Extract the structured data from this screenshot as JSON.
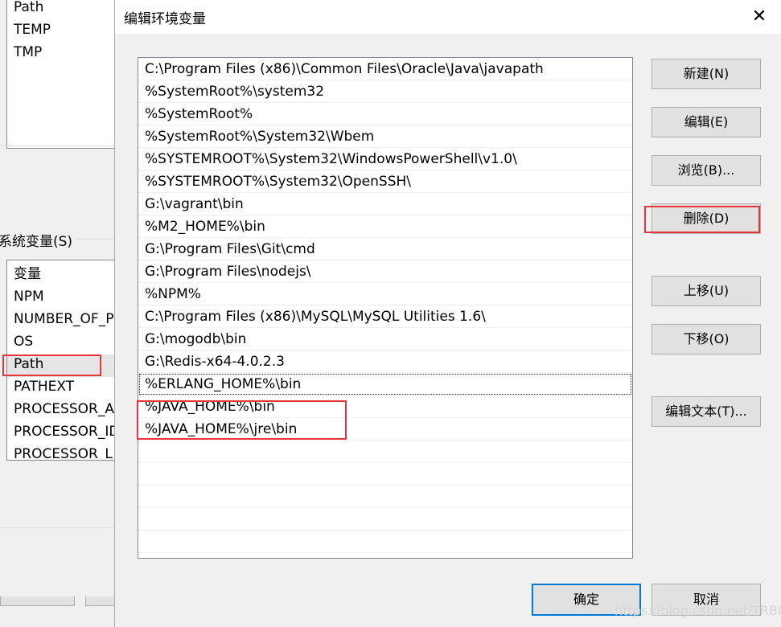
{
  "background_window": {
    "user_vars": [
      "Path",
      "TEMP",
      "TMP"
    ],
    "system_vars_label": "系统变量(S)",
    "system_vars_header": "变量",
    "system_vars": [
      "NPM",
      "NUMBER_OF_P",
      "OS",
      "Path",
      "PATHEXT",
      "PROCESSOR_A",
      "PROCESSOR_ID",
      "PROCESSOR_L"
    ]
  },
  "dialog": {
    "title": "编辑环境变量",
    "close_icon": "close-icon",
    "entries": [
      "C:\\Program Files (x86)\\Common Files\\Oracle\\Java\\javapath",
      "%SystemRoot%\\system32",
      "%SystemRoot%",
      "%SystemRoot%\\System32\\Wbem",
      "%SYSTEMROOT%\\System32\\WindowsPowerShell\\v1.0\\",
      "%SYSTEMROOT%\\System32\\OpenSSH\\",
      "G:\\vagrant\\bin",
      "%M2_HOME%\\bin",
      "G:\\Program Files\\Git\\cmd",
      "G:\\Program Files\\nodejs\\",
      "%NPM%",
      "C:\\Program Files (x86)\\MySQL\\MySQL Utilities 1.6\\",
      "G:\\mogodb\\bin",
      "G:\\Redis-x64-4.0.2.3",
      "%ERLANG_HOME%\\bin",
      "%JAVA_HOME%\\bin",
      "%JAVA_HOME%\\jre\\bin"
    ],
    "focused_entry": "%ERLANG_HOME%\\bin",
    "buttons": {
      "new": "新建(N)",
      "edit": "编辑(E)",
      "browse": "浏览(B)...",
      "delete": "删除(D)",
      "up": "上移(U)",
      "down": "下移(O)",
      "edit_text": "编辑文本(T)...",
      "ok": "确定",
      "cancel": "取消"
    },
    "highlight_color": "#e8353b",
    "accent_color": "#0078d7"
  },
  "watermark": "https://blog.csdn.net/TRBIIT"
}
